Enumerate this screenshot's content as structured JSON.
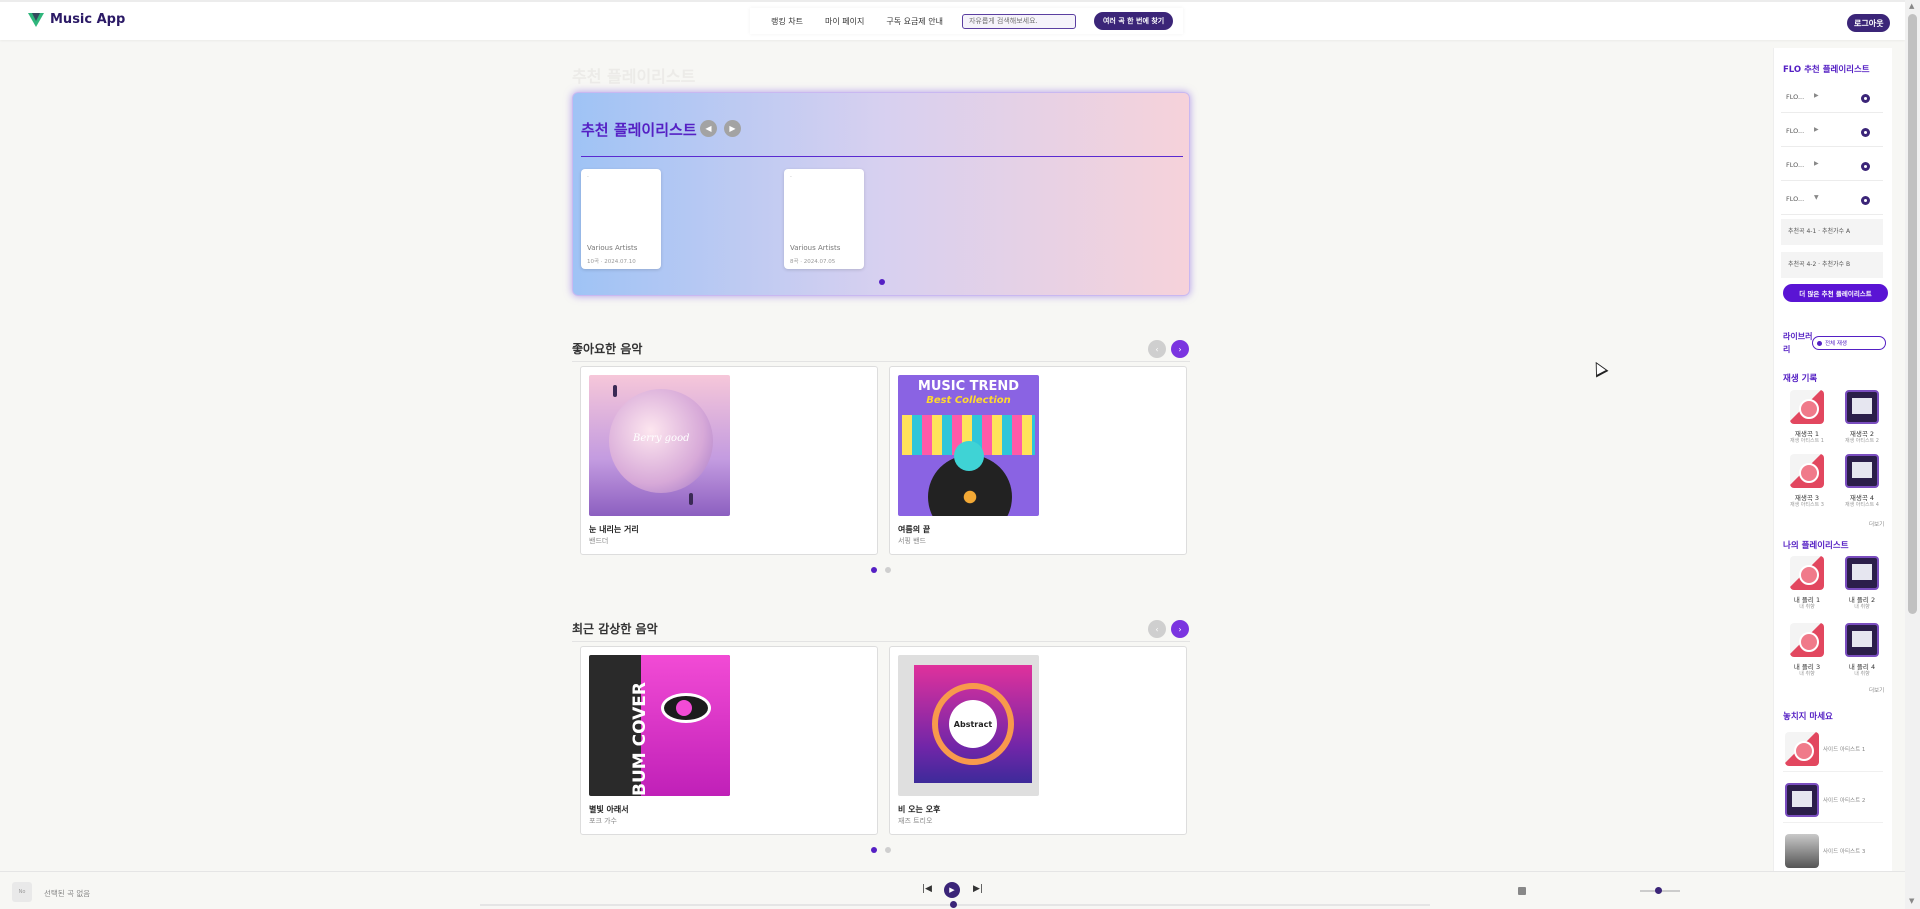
{
  "header": {
    "app_name": "Music App",
    "nav": [
      "랭킹 차트",
      "마이 페이지",
      "구독 요금제 안내"
    ],
    "search_placeholder": "자유롭게 검색해보세요.",
    "find_button": "여러 곡 한 번에 찾기",
    "logout": "로그아웃"
  },
  "hero": {
    "ghost_title": "추천 플레이리스트",
    "title": "추천 플레이리스트",
    "prev": "◀",
    "next": "▶",
    "cards": [
      {
        "dot": "·",
        "artist": "Various Artists",
        "meta": "10곡 · 2024.07.10"
      },
      {
        "dot": "·",
        "artist": "Various Artists",
        "meta": "8곡 · 2024.07.05"
      }
    ]
  },
  "liked": {
    "title": "좋아요한 음악",
    "prev": "‹",
    "next": "›",
    "cards": [
      {
        "title": "눈 내리는 거리",
        "artist": "밴드더",
        "art_text": "Berry good"
      },
      {
        "title": "여름의 끝",
        "artist": "서핑 밴드",
        "art_t1": "MUSIC TREND",
        "art_t2": "Best Collection"
      }
    ]
  },
  "recent": {
    "title": "최근 감상한 음악",
    "prev": "‹",
    "next": "›",
    "cards": [
      {
        "title": "별빛 아래서",
        "artist": "포크 가수",
        "art_text": "ALBUM COVER"
      },
      {
        "title": "비 오는 오후",
        "artist": "재즈 트리오",
        "art_text": "Abstract"
      }
    ]
  },
  "sidebar": {
    "flo_title": "FLO 추천 플레이리스트",
    "flo_rows": [
      {
        "name": "FLO...",
        "toggle": "▶"
      },
      {
        "name": "FLO...",
        "toggle": "▶"
      },
      {
        "name": "FLO...",
        "toggle": "▶"
      },
      {
        "name": "FLO...",
        "toggle": "▼"
      }
    ],
    "flo_subs": [
      "추천곡 4-1 · 추천가수 A",
      "추천곡 4-2 · 추천가수 B"
    ],
    "more_flo": "더 많은 추천 플레이리스트",
    "library_label": "라이브러리",
    "play_all": "전체 재생",
    "history_title": "재생 기록",
    "history": [
      {
        "title": "재생곡 1",
        "sub": "재생 아티스트 1"
      },
      {
        "title": "재생곡 2",
        "sub": "재생 아티스트 2"
      },
      {
        "title": "재생곡 3",
        "sub": "재생 아티스트 3"
      },
      {
        "title": "재생곡 4",
        "sub": "재생 아티스트 4"
      }
    ],
    "more": "더보기",
    "my_title": "나의 플레이리스트",
    "my": [
      {
        "title": "내 플리 1",
        "sub": "내 취향"
      },
      {
        "title": "내 플리 2",
        "sub": "내 취향"
      },
      {
        "title": "내 플리 3",
        "sub": "내 취향"
      },
      {
        "title": "내 플리 4",
        "sub": "내 취향"
      }
    ],
    "miss_title": "놓치지 마세요",
    "miss": [
      "사이드 아티스트 1",
      "사이드 아티스트 2",
      "사이드 아티스트 3"
    ]
  },
  "player": {
    "cover": "No",
    "title": "선택된 곡 없음",
    "prev": "|◀",
    "play": "▶",
    "next": "▶|",
    "progress": 0.5,
    "volume": 0.4
  },
  "colors": {
    "accent": "#5520c4",
    "dark": "#3b2578"
  }
}
